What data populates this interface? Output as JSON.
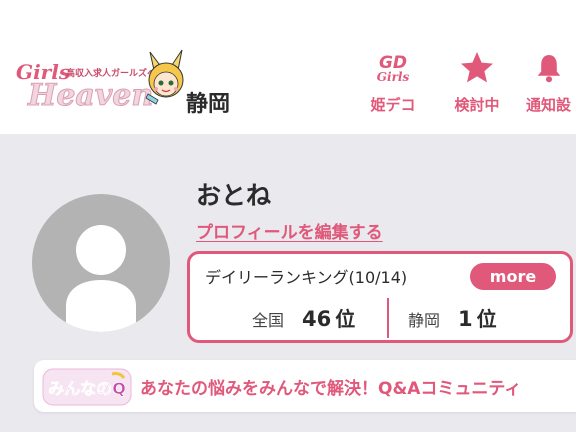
{
  "header": {
    "logo": {
      "small": "Girls",
      "tagline": "高収入求人ガールズヘ",
      "main": "Heaven"
    },
    "region": "静岡",
    "nav": [
      {
        "icon": "girls-deco-icon",
        "icon_text": "GD\nGirls",
        "label": "姫デコ"
      },
      {
        "icon": "star-icon",
        "label": "検討中"
      },
      {
        "icon": "bell-icon",
        "label": "通知設"
      }
    ]
  },
  "profile": {
    "name": "おとね",
    "edit_link": "プロフィールを編集する"
  },
  "ranking": {
    "title": "デイリーランキング(10/14)",
    "more": "more",
    "national": {
      "label": "全国",
      "rank": "46",
      "unit": "位"
    },
    "local": {
      "label": "静岡",
      "rank": "1",
      "unit": "位"
    }
  },
  "banner": {
    "logo_text": "みんなのQ",
    "text": "あなたの悩みをみんなで解決！Q&Aコミュニティ"
  },
  "colors": {
    "accent": "#e0587a",
    "background": "#e9e9ee",
    "avatar": "#b3b3b3"
  }
}
